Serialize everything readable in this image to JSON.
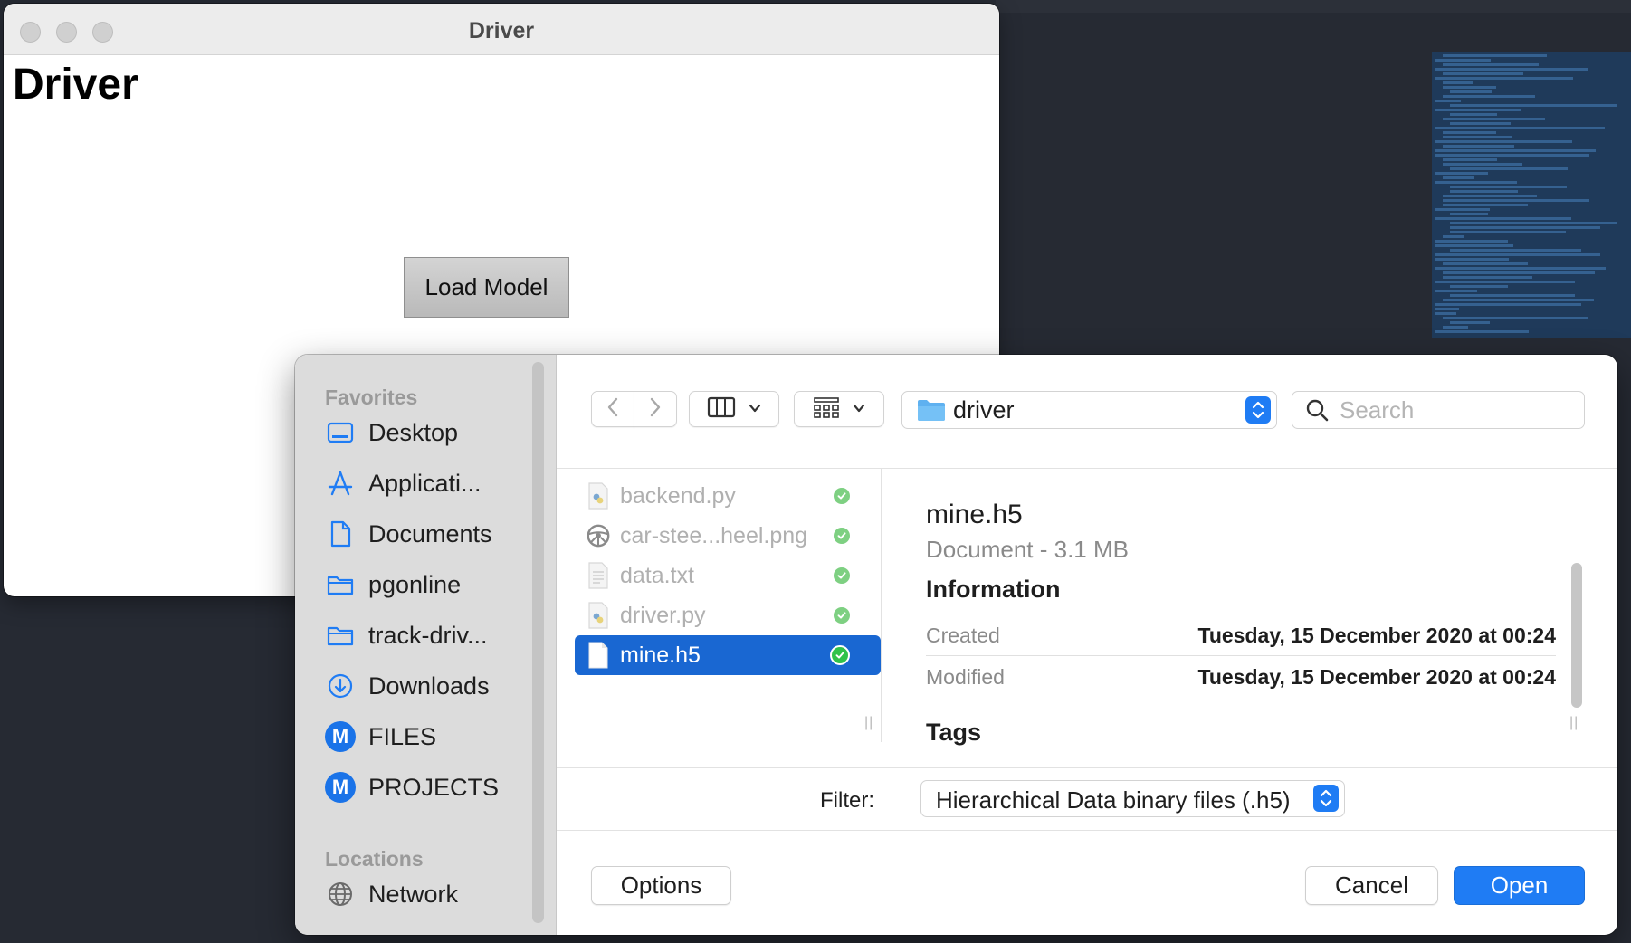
{
  "app_window": {
    "title": "Driver",
    "heading": "Driver",
    "load_button": "Load Model"
  },
  "dialog": {
    "sidebar": {
      "favorites_title": "Favorites",
      "favorites": [
        {
          "label": "Desktop",
          "icon": "desktop-icon"
        },
        {
          "label": "Applicati...",
          "icon": "applications-icon"
        },
        {
          "label": "Documents",
          "icon": "document-icon"
        },
        {
          "label": "pgonline",
          "icon": "folder-icon"
        },
        {
          "label": "track-driv...",
          "icon": "folder-icon"
        },
        {
          "label": "Downloads",
          "icon": "downloads-icon"
        },
        {
          "label": "FILES",
          "icon": "m-badge-icon"
        },
        {
          "label": "PROJECTS",
          "icon": "m-badge-icon"
        }
      ],
      "locations_title": "Locations",
      "locations": [
        {
          "label": "Network",
          "icon": "globe-icon"
        }
      ]
    },
    "toolbar": {
      "path": "driver",
      "search_placeholder": "Search"
    },
    "files": [
      {
        "name": "backend.py",
        "icon": "python-file-icon",
        "selected": false
      },
      {
        "name": "car-stee...heel.png",
        "icon": "steering-wheel-icon",
        "selected": false
      },
      {
        "name": "data.txt",
        "icon": "text-file-icon",
        "selected": false
      },
      {
        "name": "driver.py",
        "icon": "python-file-icon",
        "selected": false
      },
      {
        "name": "mine.h5",
        "icon": "document-icon",
        "selected": true
      }
    ],
    "preview": {
      "name": "mine.h5",
      "kind": "Document - 3.1 MB",
      "info_title": "Information",
      "created_label": "Created",
      "created_value": "Tuesday, 15 December 2020 at 00:24",
      "modified_label": "Modified",
      "modified_value": "Tuesday, 15 December 2020 at 00:24",
      "tags_title": "Tags"
    },
    "filter": {
      "label": "Filter:",
      "value": "Hierarchical Data binary files (.h5)"
    },
    "buttons": {
      "options": "Options",
      "cancel": "Cancel",
      "open": "Open"
    }
  },
  "colors": {
    "accent": "#1f7cf4",
    "selection": "#1967d2",
    "sync_check": "#7ed082"
  }
}
